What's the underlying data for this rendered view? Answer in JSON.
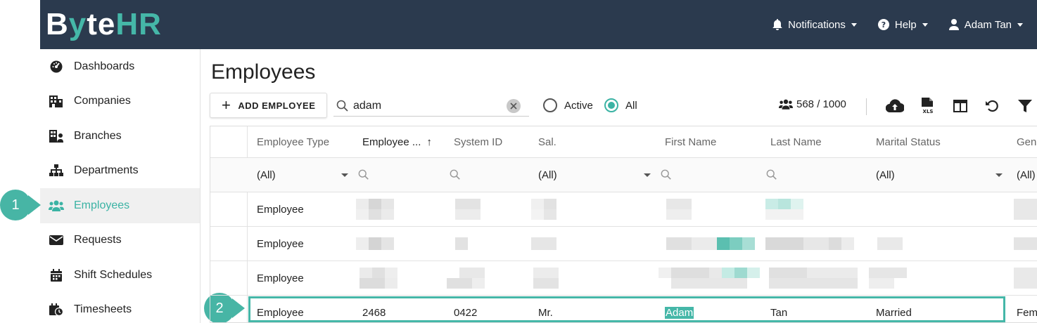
{
  "brand": {
    "logo_white_1": "B",
    "logo_green": "y",
    "logo_white_2": "te",
    "logo_green_2": "HR"
  },
  "topnav": {
    "notifications": "Notifications",
    "help": "Help",
    "user": "Adam Tan"
  },
  "sidebar": {
    "items": [
      {
        "label": "Dashboards",
        "icon": "dashboard-icon"
      },
      {
        "label": "Companies",
        "icon": "building-icon"
      },
      {
        "label": "Branches",
        "icon": "branch-icon"
      },
      {
        "label": "Departments",
        "icon": "sitemap-icon"
      },
      {
        "label": "Employees",
        "icon": "users-icon",
        "active": true
      },
      {
        "label": "Requests",
        "icon": "envelope-icon"
      },
      {
        "label": "Shift Schedules",
        "icon": "calendar-icon"
      },
      {
        "label": "Timesheets",
        "icon": "calendar-clock-icon"
      }
    ]
  },
  "callouts": {
    "one": "1",
    "two": "2"
  },
  "page": {
    "title": "Employees"
  },
  "toolbar": {
    "add_label": "ADD EMPLOYEE",
    "search_value": "adam",
    "radio_active": "Active",
    "radio_all": "All",
    "count": "568 / 1000"
  },
  "grid": {
    "columns": [
      "Employee Type",
      "Employee ...",
      "System ID",
      "Sal.",
      "First Name",
      "Last Name",
      "Marital Status",
      "Gend"
    ],
    "sort_arrow": "↑",
    "filters": {
      "employee_type": "(All)",
      "sal": "(All)",
      "marital_status": "(All)",
      "gender": "(All)"
    },
    "rows": [
      {
        "employee_type": "Employee"
      },
      {
        "employee_type": "Employee"
      },
      {
        "employee_type": "Employee"
      },
      {
        "employee_type": "Employee",
        "employee_no": "2468",
        "system_id": "0422",
        "sal": "Mr.",
        "first_name": "Adam",
        "last_name": "Tan",
        "marital_status": "Married",
        "gender": "Fem"
      }
    ]
  },
  "colors": {
    "accent": "#45b7a8",
    "topbar": "#2b3a4e"
  }
}
